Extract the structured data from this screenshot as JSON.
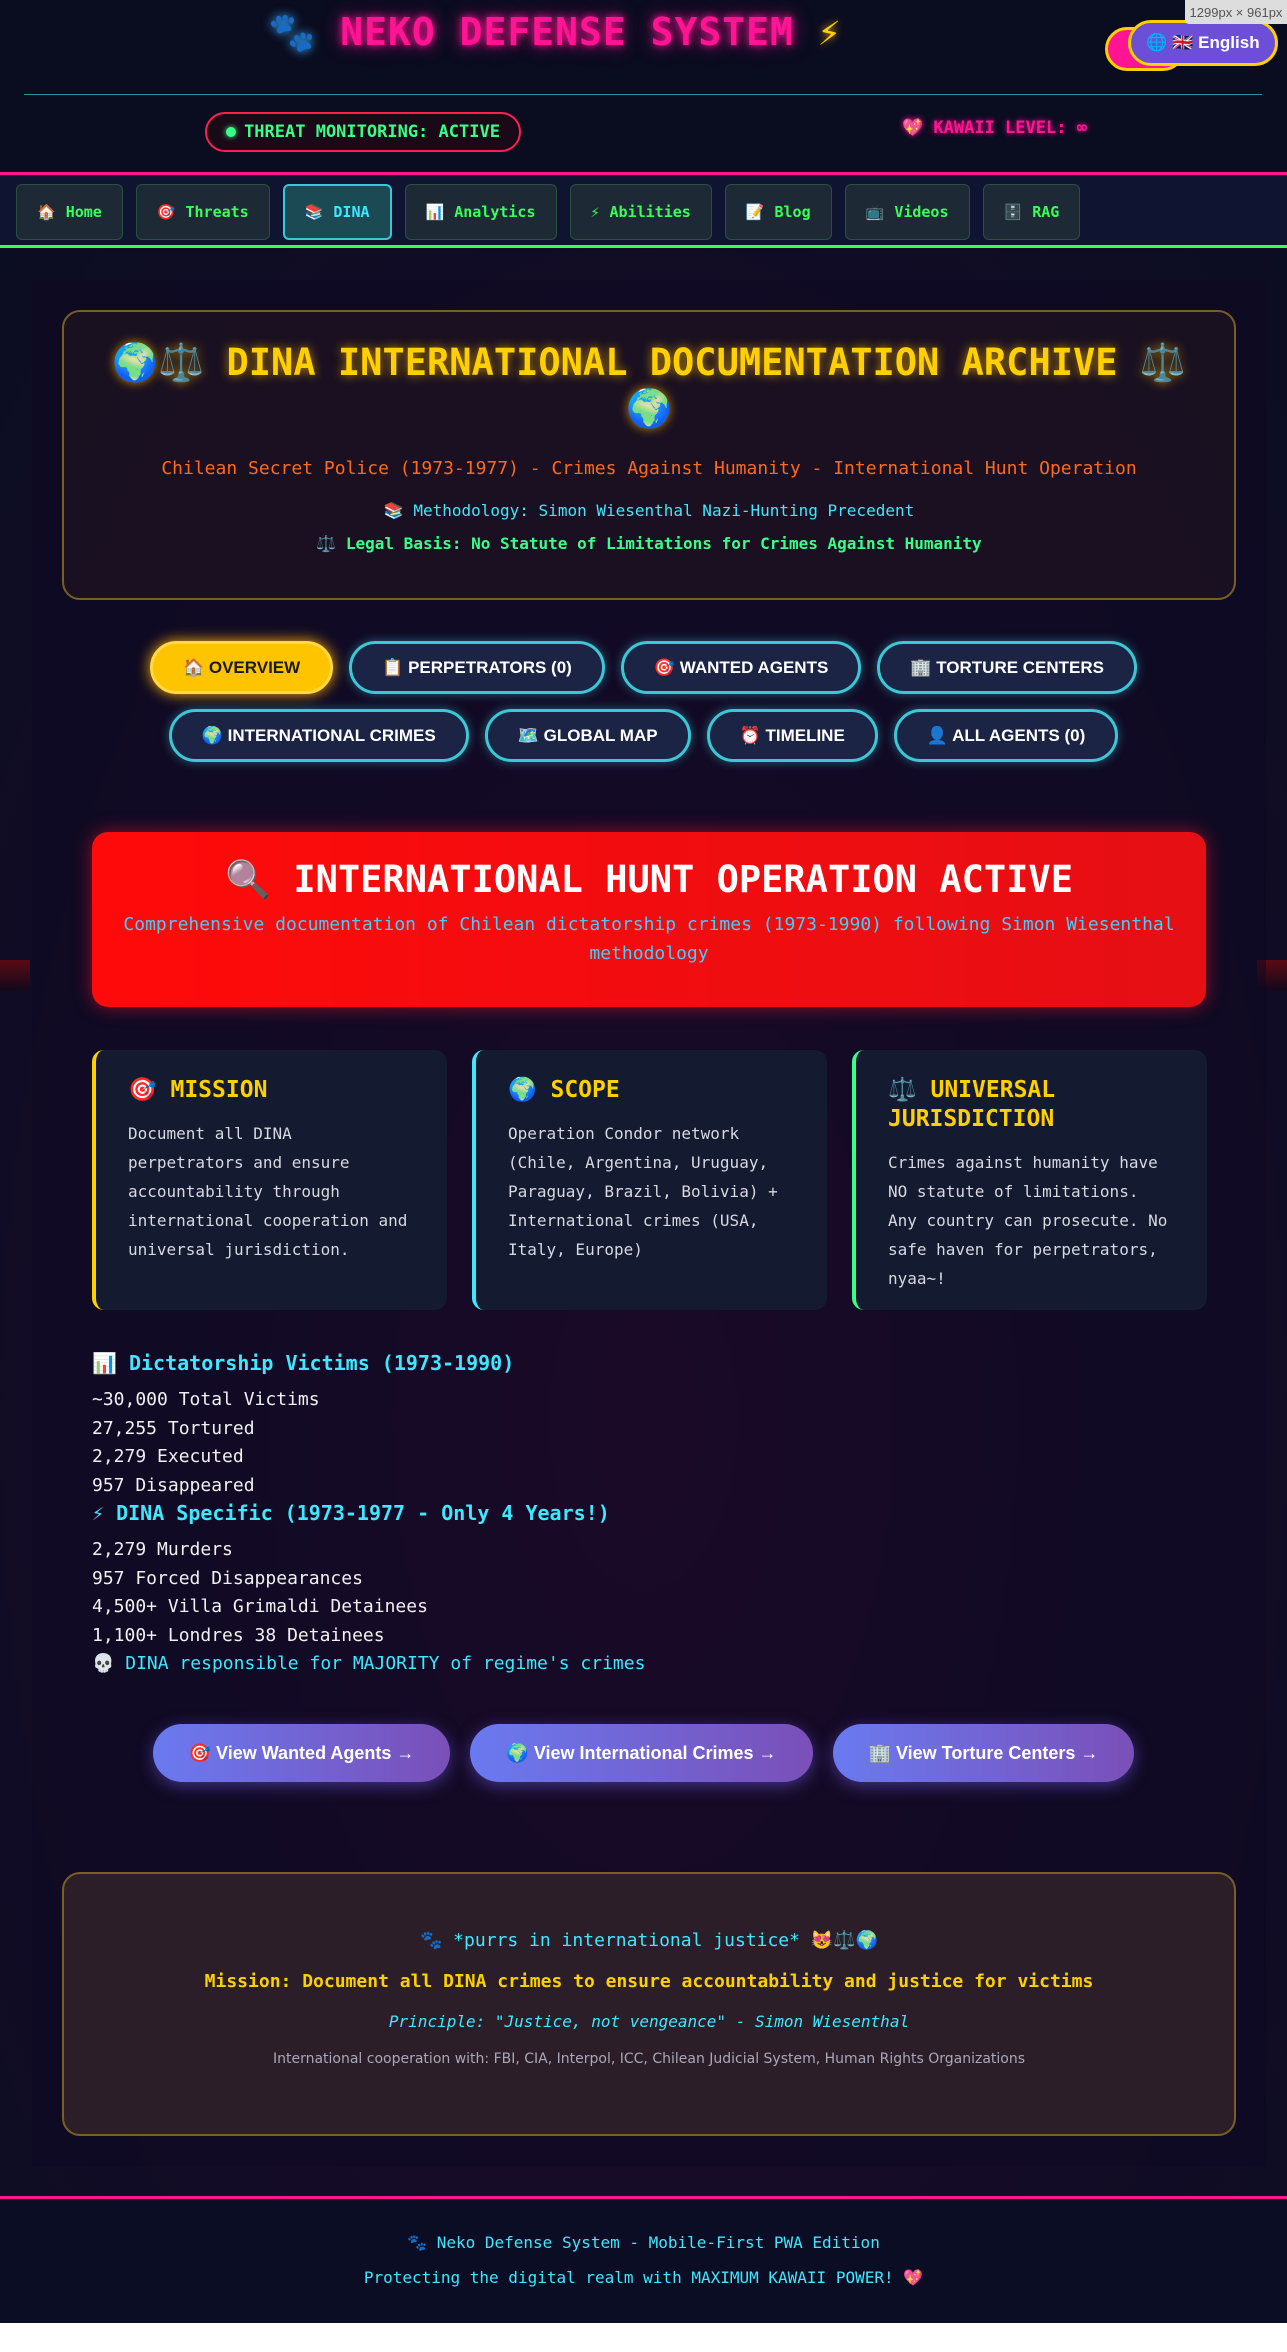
{
  "header": {
    "logo_paw": "🐾",
    "logo_text": "NEKO DEFENSE SYSTEM",
    "logo_bolt": "⚡",
    "language_button": "🌐 🇬🇧 English",
    "dims_badge": "1299px × 961px",
    "status_pill": "THREAT MONITORING: ACTIVE",
    "kawaii_level": "💖 KAWAII LEVEL: ∞"
  },
  "nav": {
    "items": [
      {
        "icon": "🏠",
        "label": "Home"
      },
      {
        "icon": "🎯",
        "label": "Threats"
      },
      {
        "icon": "📚",
        "label": "DINA"
      },
      {
        "icon": "📊",
        "label": "Analytics"
      },
      {
        "icon": "⚡",
        "label": "Abilities"
      },
      {
        "icon": "📝",
        "label": "Blog"
      },
      {
        "icon": "📺",
        "label": "Videos"
      },
      {
        "icon": "🗄️",
        "label": "RAG"
      }
    ]
  },
  "archive": {
    "title": "🌍⚖️ DINA INTERNATIONAL DOCUMENTATION ARCHIVE ⚖️🌍",
    "subtitle": "Chilean Secret Police (1973-1977) - Crimes Against Humanity - International Hunt Operation",
    "methodology": "📚 Methodology: Simon Wiesenthal Nazi-Hunting Precedent",
    "legal_basis": "⚖️ Legal Basis: No Statute of Limitations for Crimes Against Humanity"
  },
  "tabs": {
    "row1": [
      "🏠 OVERVIEW",
      "📋 PERPETRATORS (0)",
      "🎯 WANTED AGENTS",
      "🏢 TORTURE CENTERS"
    ],
    "row2": [
      "🌍 INTERNATIONAL CRIMES",
      "🗺️ GLOBAL MAP",
      "⏰ TIMELINE",
      "👤 ALL AGENTS (0)"
    ]
  },
  "hunt": {
    "title": "🔍 INTERNATIONAL HUNT OPERATION ACTIVE",
    "subtitle": "Comprehensive documentation of Chilean dictatorship crimes (1973-1990) following Simon Wiesenthal methodology"
  },
  "cards": [
    {
      "title": "🎯 MISSION",
      "body": "Document all DINA perpetrators and ensure accountability through international cooperation and universal jurisdiction."
    },
    {
      "title": "🌍 SCOPE",
      "body": "Operation Condor network (Chile, Argentina, Uruguay, Paraguay, Brazil, Bolivia) + International crimes (USA, Italy, Europe)"
    },
    {
      "title": "⚖️ UNIVERSAL JURISDICTION",
      "body": "Crimes against humanity have NO statute of limitations. Any country can prosecute. No safe haven for perpetrators, nyaa~!"
    }
  ],
  "stats": {
    "victims_heading": "📊 Dictatorship Victims (1973-1990)",
    "victims": [
      "~30,000 Total Victims",
      "27,255 Tortured",
      "2,279 Executed",
      "957 Disappeared"
    ],
    "dina_heading": "⚡ DINA Specific (1973-1977 - Only 4 Years!)",
    "dina": [
      "2,279 Murders",
      "957 Forced Disappearances",
      "4,500+ Villa Grimaldi Detainees",
      "1,100+ Londres 38 Detainees"
    ],
    "footnote": "💀 DINA responsible for MAJORITY of regime's crimes"
  },
  "ctas": [
    "🎯 View Wanted Agents →",
    "🌍 View International Crimes →",
    "🏢 View Torture Centers →"
  ],
  "purr": {
    "line1": "🐾 *purrs in international justice* 😻⚖️🌍",
    "line2": "Mission: Document all DINA crimes to ensure accountability and justice for victims",
    "line3": "Principle: \"Justice, not vengeance\" - Simon Wiesenthal",
    "line4": "International cooperation with: FBI, CIA, Interpol, ICC, Chilean Judicial System, Human Rights Organizations"
  },
  "footer": {
    "line1": "🐾 Neko Defense System - Mobile-First PWA Edition",
    "line2": "Protecting the digital realm with MAXIMUM KAWAII POWER! 💖"
  }
}
